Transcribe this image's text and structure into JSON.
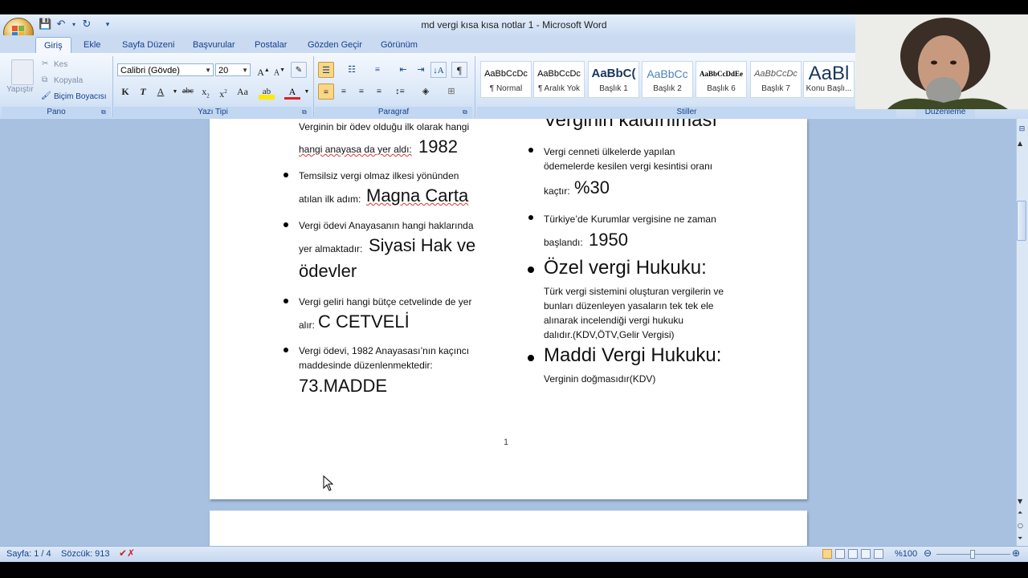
{
  "window": {
    "title": "md vergi kısa kısa notlar 1 - Microsoft Word"
  },
  "tabs": [
    "Giriş",
    "Ekle",
    "Sayfa Düzeni",
    "Başvurular",
    "Postalar",
    "Gözden Geçir",
    "Görünüm"
  ],
  "ribbon": {
    "clipboard": {
      "paste": "Yapıştır",
      "cut": "Kes",
      "copy": "Kopyala",
      "format_painter": "Biçim Boyacısı",
      "label": "Pano"
    },
    "font": {
      "name": "Calibri (Gövde)",
      "size": "20",
      "label": "Yazı Tipi"
    },
    "paragraph": {
      "label": "Paragraf"
    },
    "styles": {
      "label": "Stiller",
      "items": [
        {
          "preview": "AaBbCcDc",
          "name": "¶ Normal"
        },
        {
          "preview": "AaBbCcDc",
          "name": "¶ Aralık Yok"
        },
        {
          "preview": "AaBbC(",
          "name": "Başlık 1"
        },
        {
          "preview": "AaBbCc",
          "name": "Başlık 2"
        },
        {
          "preview": "AaBbCcDdEe",
          "name": "Başlık 6"
        },
        {
          "preview": "AaBbCcDc",
          "name": "Başlık 7"
        },
        {
          "preview": "AaBl",
          "name": "Konu Başlı..."
        }
      ]
    },
    "editing": {
      "label": "Düzenleme"
    }
  },
  "document": {
    "left_column": [
      {
        "small": "Verginin bir ödev olduğu ilk olarak hangi",
        "small2": "hangi anayasa da yer aldı:",
        "large": "1982"
      },
      {
        "small": "Temsilsiz vergi olmaz ilkesi yönünden",
        "small2": "atılan ilk adım:",
        "large": "Magna Carta"
      },
      {
        "small": "Vergi ödevi Anayasanın hangi haklarında",
        "small2": "yer almaktadır:",
        "large": "Siyasi Hak ve",
        "large2": "ödevler"
      },
      {
        "small": "Vergi geliri hangi bütçe cetvelinde de yer",
        "small2": "alır:",
        "large": "C CETVELİ"
      },
      {
        "small": "Vergi ödevi, 1982 Anayasası’nın kaçıncı",
        "small2": "maddesinde düzenlenmektedir:",
        "large": "73.MADDE"
      }
    ],
    "right_column": {
      "top_heading_cut": "Verginin kaldırılması",
      "items": [
        {
          "lines": [
            "Vergi cenneti ülkelerde yapılan",
            "ödemelerde kesilen vergi kesintisi oranı"
          ],
          "tail": "kaçtır:",
          "large": "%30"
        },
        {
          "lines": [
            "Türkiye’de Kurumlar vergisine ne zaman"
          ],
          "tail": "başlandı:",
          "large": "1950"
        }
      ],
      "heading1": "Özel vergi Hukuku:",
      "heading1_body": [
        "Türk vergi sistemini oluşturan vergilerin ve",
        "bunları düzenleyen yasaların tek tek ele",
        "alınarak incelendiği vergi hukuku",
        "dalıdır.(KDV,ÖTV,Gelir Vergisi)"
      ],
      "heading2": "Maddi Vergi Hukuku:",
      "heading2_body": "Verginin doğmasıdır(KDV)"
    },
    "page_number": "1"
  },
  "status": {
    "page": "Sayfa: 1 / 4",
    "words": "Sözcük: 913",
    "zoom": "%100"
  }
}
